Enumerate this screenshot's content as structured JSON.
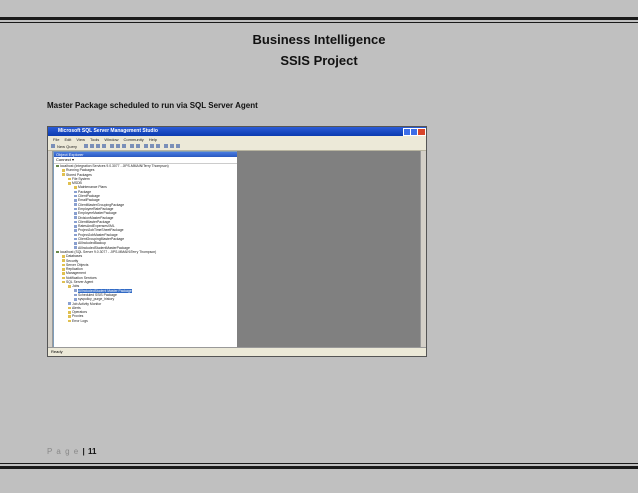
{
  "header": {
    "title": "Business Intelligence",
    "subtitle": "SSIS Project"
  },
  "caption": "Master Package scheduled to run via SQL Server Agent",
  "footer": {
    "page_word": "P a g e",
    "separator": "|",
    "page_number": "11"
  },
  "screenshot": {
    "window_title": "Microsoft SQL Server Management Studio",
    "menu": [
      "File",
      "Edit",
      "View",
      "Tools",
      "Window",
      "Community",
      "Help"
    ],
    "toolbar_label": "New Query",
    "object_explorer": {
      "title": "Object Explorer",
      "toolbar": "Connect ▾",
      "tree": [
        {
          "indent": 0,
          "label": "localhost (Integration Services 9.0.3077 - JIPS-MMAIN\\Terry Thompson)",
          "icon": "srv"
        },
        {
          "indent": 1,
          "label": "Running Packages",
          "icon": "folder"
        },
        {
          "indent": 1,
          "label": "Stored Packages",
          "icon": "folder"
        },
        {
          "indent": 2,
          "label": "File System",
          "icon": "folder"
        },
        {
          "indent": 2,
          "label": "MSDB",
          "icon": "folder"
        },
        {
          "indent": 3,
          "label": "Maintenance Plans",
          "icon": "folder"
        },
        {
          "indent": 3,
          "label": "Package",
          "icon": "pkg"
        },
        {
          "indent": 3,
          "label": "ClientPackage",
          "icon": "pkg"
        },
        {
          "indent": 3,
          "label": "EmailPackage",
          "icon": "pkg"
        },
        {
          "indent": 3,
          "label": "ClientMasterGroupingPackage",
          "icon": "pkg"
        },
        {
          "indent": 3,
          "label": "EmployeeRatePackage",
          "icon": "pkg"
        },
        {
          "indent": 3,
          "label": "EmployeeMasterPackage",
          "icon": "pkg"
        },
        {
          "indent": 3,
          "label": "DivisionMasterPackage",
          "icon": "pkg"
        },
        {
          "indent": 3,
          "label": "ClientMasterPackage",
          "icon": "pkg"
        },
        {
          "indent": 3,
          "label": "RatesAndExpensesXML",
          "icon": "pkg"
        },
        {
          "indent": 3,
          "label": "ProjectJobTimeSheetPackage",
          "icon": "pkg"
        },
        {
          "indent": 3,
          "label": "ProjectJobMasterPackage",
          "icon": "pkg"
        },
        {
          "indent": 3,
          "label": "ClientGroupingMasterPackage",
          "icon": "pkg"
        },
        {
          "indent": 3,
          "label": "AllIncludedBackup",
          "icon": "pkg"
        },
        {
          "indent": 3,
          "label": "AllIncludedStudentMasterPackage",
          "icon": "pkg"
        },
        {
          "indent": 0,
          "label": "localhost (SQL Server 9.0.3077 - JIPS-MMAIN\\Terry Thompson)",
          "icon": "srv"
        },
        {
          "indent": 1,
          "label": "Databases",
          "icon": "folder"
        },
        {
          "indent": 1,
          "label": "Security",
          "icon": "folder"
        },
        {
          "indent": 1,
          "label": "Server Objects",
          "icon": "folder"
        },
        {
          "indent": 1,
          "label": "Replication",
          "icon": "folder"
        },
        {
          "indent": 1,
          "label": "Management",
          "icon": "folder"
        },
        {
          "indent": 1,
          "label": "Notification Services",
          "icon": "folder"
        },
        {
          "indent": 1,
          "label": "SQL Server Agent",
          "icon": "folder"
        },
        {
          "indent": 2,
          "label": "Jobs",
          "icon": "folder"
        },
        {
          "indent": 3,
          "label": "AllIncludedStudent Master Package",
          "icon": "pkg",
          "selected": true
        },
        {
          "indent": 3,
          "label": "Scheduled SSIS Package",
          "icon": "pkg"
        },
        {
          "indent": 3,
          "label": "syspolicy_purge_history",
          "icon": "pkg"
        },
        {
          "indent": 2,
          "label": "Job Activity Monitor",
          "icon": "pkg"
        },
        {
          "indent": 2,
          "label": "Alerts",
          "icon": "folder"
        },
        {
          "indent": 2,
          "label": "Operators",
          "icon": "folder"
        },
        {
          "indent": 2,
          "label": "Proxies",
          "icon": "folder"
        },
        {
          "indent": 2,
          "label": "Error Logs",
          "icon": "folder"
        }
      ]
    },
    "status": "Ready"
  }
}
